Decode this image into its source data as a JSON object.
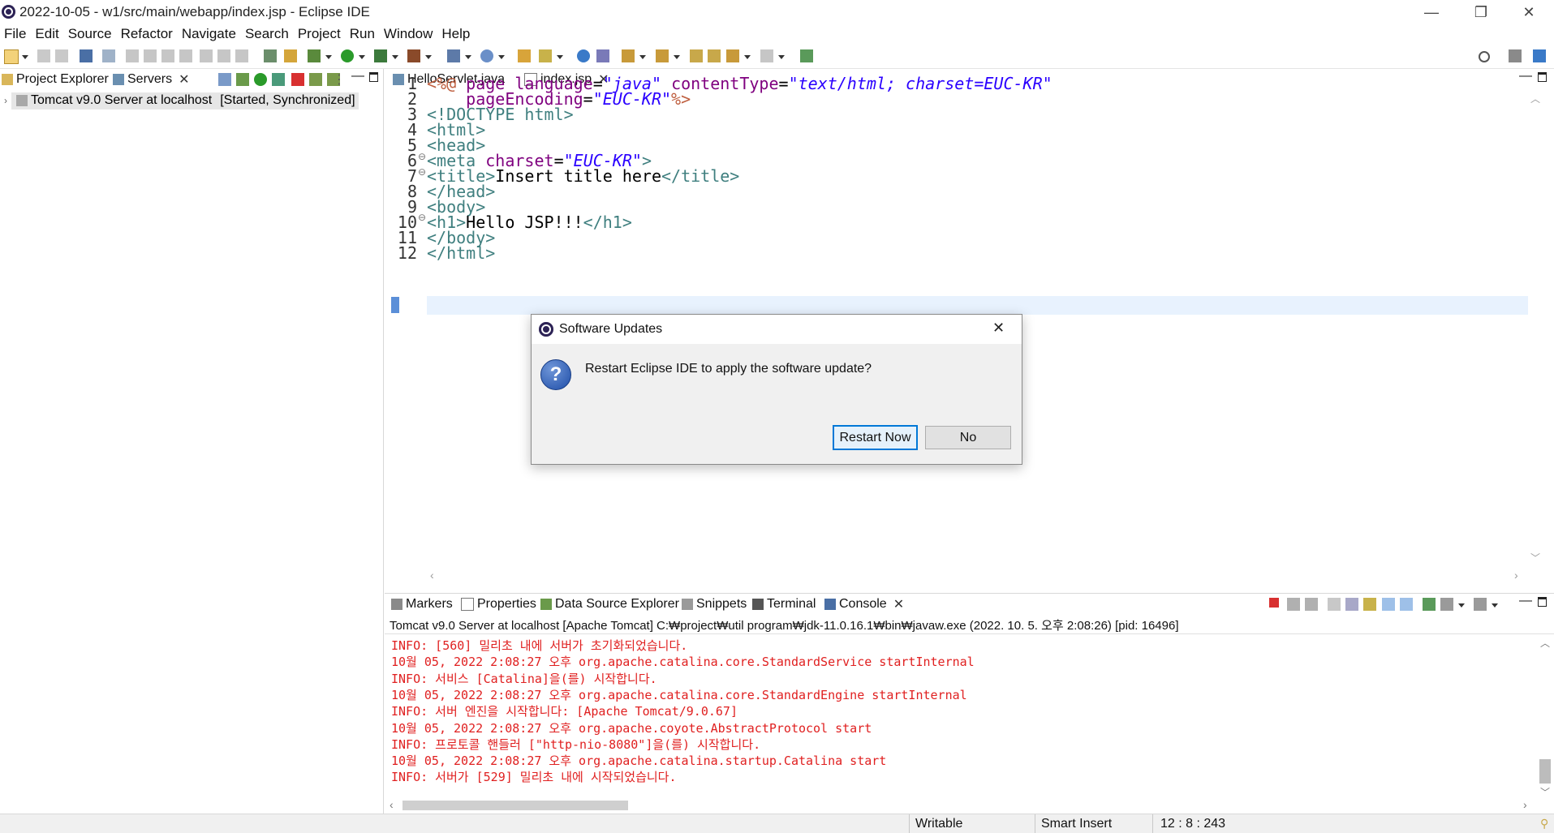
{
  "window": {
    "title": "2022-10-05 - w1/src/main/webapp/index.jsp - Eclipse IDE",
    "minimize": "—",
    "restore": "❐",
    "close": "✕"
  },
  "menu": [
    "File",
    "Edit",
    "Source",
    "Refactor",
    "Navigate",
    "Search",
    "Project",
    "Run",
    "Window",
    "Help"
  ],
  "left_panel": {
    "tabs": [
      {
        "label": "Project Explorer"
      },
      {
        "label": "Servers"
      }
    ],
    "close": "✕",
    "server_item": {
      "name": "Tomcat v9.0 Server at localhost",
      "status": "[Started, Synchronized]"
    }
  },
  "editor": {
    "tabs": [
      {
        "label": "HelloServlet.java"
      },
      {
        "label": "index.jsp"
      }
    ],
    "close": "✕",
    "line_numbers": [
      "1",
      "2",
      "3",
      "4",
      "5",
      "6",
      "7",
      "8",
      "9",
      "10",
      "11",
      "12"
    ],
    "lines": [
      "<%@ page language=\"java\" contentType=\"text/html; charset=EUC-KR\"",
      "    pageEncoding=\"EUC-KR\"%>",
      "<!DOCTYPE html>",
      "<html>",
      "<head>",
      "<meta charset=\"EUC-KR\">",
      "<title>Insert title here</title>",
      "</head>",
      "<body>",
      "<h1>Hello JSP!!!</h1>",
      "</body>",
      "</html>"
    ]
  },
  "console_panel": {
    "tabs": [
      {
        "label": "Markers"
      },
      {
        "label": "Properties"
      },
      {
        "label": "Data Source Explorer"
      },
      {
        "label": "Snippets"
      },
      {
        "label": "Terminal"
      },
      {
        "label": "Console"
      }
    ],
    "close": "✕",
    "header": "Tomcat v9.0 Server at localhost [Apache Tomcat] C:₩project₩util program₩jdk-11.0.16.1₩bin₩javaw.exe  (2022. 10. 5. 오후 2:08:26) [pid: 16496]",
    "lines": [
      "INFO: [560] 밀리초 내에 서버가 초기화되었습니다.",
      "10월 05, 2022 2:08:27 오후 org.apache.catalina.core.StandardService startInternal",
      "INFO: 서비스 [Catalina]을(를) 시작합니다.",
      "10월 05, 2022 2:08:27 오후 org.apache.catalina.core.StandardEngine startInternal",
      "INFO: 서버 엔진을 시작합니다: [Apache Tomcat/9.0.67]",
      "10월 05, 2022 2:08:27 오후 org.apache.coyote.AbstractProtocol start",
      "INFO: 프로토콜 핸들러 [\"http-nio-8080\"]을(를) 시작합니다.",
      "10월 05, 2022 2:08:27 오후 org.apache.catalina.startup.Catalina start",
      "INFO: 서버가 [529] 밀리초 내에 시작되었습니다."
    ]
  },
  "status_bar": {
    "mode": "Writable",
    "insert": "Smart Insert",
    "position": "12 : 8 : 243"
  },
  "dialog": {
    "title": "Software Updates",
    "close": "✕",
    "icon_glyph": "?",
    "message": "Restart Eclipse IDE to apply the software update?",
    "primary_button": "Restart Now",
    "secondary_button": "No"
  },
  "colors": {
    "console_text": "#e02020",
    "dialog_default_border": "#0078d7",
    "current_line_highlight": "#e8f2fe"
  }
}
